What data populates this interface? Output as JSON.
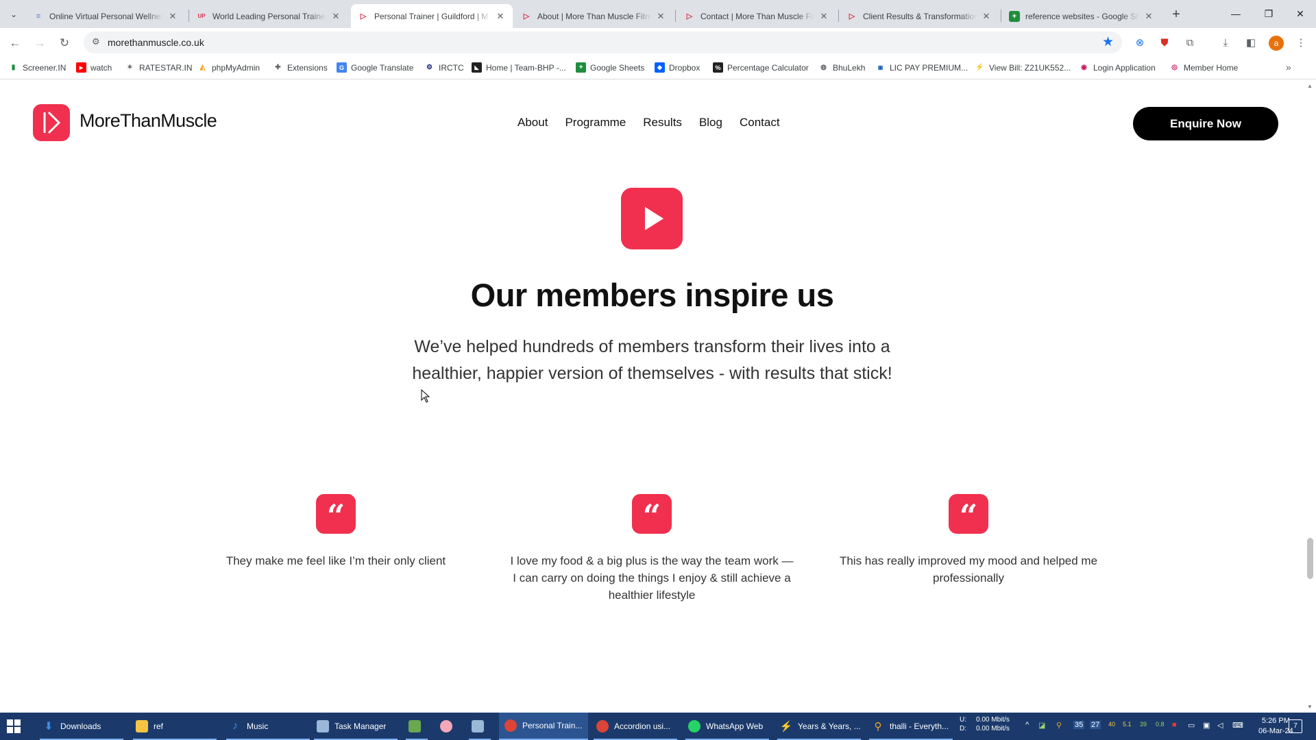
{
  "browser": {
    "tabs": [
      {
        "title": "Online Virtual Personal Wellness",
        "favicon_color": "#5a7bd8",
        "favicon_glyph": "≡"
      },
      {
        "title": "World Leading Personal Trainer",
        "favicon_color": "#e0304c",
        "favicon_glyph": "UP"
      },
      {
        "title": "Personal Trainer | Guildford | M",
        "favicon_color": "#e0304c",
        "favicon_glyph": "▷"
      },
      {
        "title": "About | More Than Muscle Fitne",
        "favicon_color": "#e0304c",
        "favicon_glyph": "▷"
      },
      {
        "title": "Contact | More Than Muscle Fit",
        "favicon_color": "#e0304c",
        "favicon_glyph": "▷"
      },
      {
        "title": "Client Results & Transformation",
        "favicon_color": "#e0304c",
        "favicon_glyph": "▷"
      },
      {
        "title": "reference websites - Google Sh",
        "favicon_color": "#1e8e3e",
        "favicon_glyph": "+"
      }
    ],
    "active_tab_index": 2,
    "url": "morethanmuscle.co.uk",
    "bookmarks": [
      {
        "label": "Screener.IN",
        "icon": "bar-chart-icon",
        "color": "#1e8e3e"
      },
      {
        "label": "watch",
        "icon": "youtube-icon",
        "color": "#ff0000"
      },
      {
        "label": "RATESTAR.IN",
        "icon": "star-icon",
        "color": "#5f6368"
      },
      {
        "label": "phpMyAdmin",
        "icon": "phpmyadmin-icon",
        "color": "#f89c0e"
      },
      {
        "label": "Extensions",
        "icon": "puzzle-icon",
        "color": "#5f6368"
      },
      {
        "label": "Google Translate",
        "icon": "translate-icon",
        "color": "#4285f4"
      },
      {
        "label": "IRCTC",
        "icon": "irctc-icon",
        "color": "#1a237e"
      },
      {
        "label": "Home | Team-BHP -...",
        "icon": "team-bhp-icon",
        "color": "#222222"
      },
      {
        "label": "Google Sheets",
        "icon": "sheets-icon",
        "color": "#1e8e3e"
      },
      {
        "label": "Dropbox",
        "icon": "dropbox-icon",
        "color": "#0061fe"
      },
      {
        "label": "Percentage Calculator",
        "icon": "percent-icon",
        "color": "#222222"
      },
      {
        "label": "BhuLekh",
        "icon": "globe-icon",
        "color": "#5f6368"
      },
      {
        "label": "LIC PAY PREMIUM...",
        "icon": "lic-icon",
        "color": "#1a5fb4"
      },
      {
        "label": "View Bill: Z21UK552...",
        "icon": "bill-icon",
        "color": "#3c4043"
      },
      {
        "label": "Login Application",
        "icon": "login-icon",
        "color": "#c2185b"
      },
      {
        "label": "Member Home",
        "icon": "member-icon",
        "color": "#c2185b"
      }
    ]
  },
  "site": {
    "brand": "MoreThanMuscle",
    "accent_color": "#f0304e",
    "nav": [
      "About",
      "Programme",
      "Results",
      "Blog",
      "Contact"
    ],
    "cta_label": "Enquire Now",
    "heading": "Our members inspire us",
    "subtext": "We’ve helped hundreds of members transform their lives into a healthier, happier version of themselves - with results that stick!",
    "testimonials": [
      "They make me feel like I’m their only client",
      "I love my food & a big plus is the way the team work — I can carry on doing the things I enjoy & still achieve a healthier lifestyle",
      "This has really improved my mood and helped me professionally"
    ]
  },
  "taskbar": {
    "items": [
      {
        "label": "Downloads",
        "icon": "download-folder-icon",
        "color": "#3b8eea"
      },
      {
        "label": "ref",
        "icon": "folder-icon",
        "color": "#f5c542"
      },
      {
        "label": "Music",
        "icon": "music-note-icon",
        "color": "#3b8eea"
      },
      {
        "label": "Task Manager",
        "icon": "task-manager-icon",
        "color": "#9bb8d8"
      },
      {
        "label": "",
        "icon": "notepad-green-icon",
        "color": "#6aa84f"
      },
      {
        "label": "",
        "icon": "pig-icon",
        "color": "#f4a8b8"
      },
      {
        "label": "",
        "icon": "document-icon",
        "color": "#9bb8d8"
      },
      {
        "label": "Personal Train...",
        "icon": "chrome-icon",
        "color": "#db4437"
      },
      {
        "label": "Accordion usi...",
        "icon": "chrome-icon",
        "color": "#db4437"
      },
      {
        "label": "WhatsApp Web",
        "icon": "whatsapp-icon",
        "color": "#25d366"
      },
      {
        "label": "Years & Years, ...",
        "icon": "winamp-icon",
        "color": "#cccccc"
      },
      {
        "label": "thalli - Everyth...",
        "icon": "search-everything-icon",
        "color": "#f5a623"
      }
    ],
    "active_item": 7,
    "net_upload_label": "U:",
    "net_download_label": "D:",
    "net_upload": "0.00 Mbit/s",
    "net_download": "0.00 Mbit/s",
    "tray_numbers": [
      "40",
      "5.1",
      "39",
      "0.8"
    ],
    "tray_badges": [
      "35",
      "27"
    ],
    "time": "5:26 PM",
    "date": "06-Mar-24",
    "notification_count": "7"
  }
}
